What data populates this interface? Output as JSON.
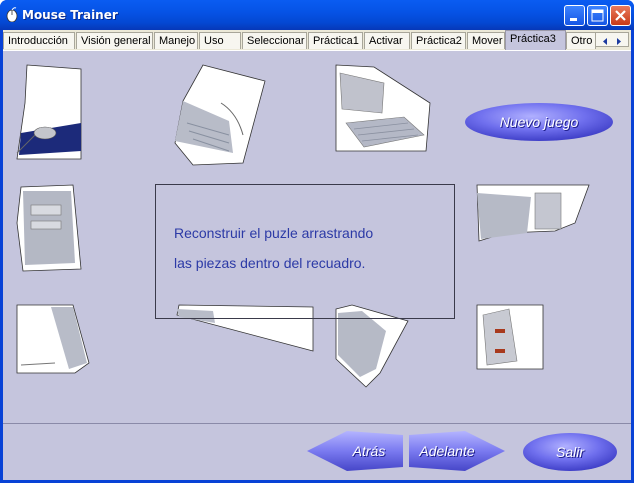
{
  "window": {
    "title": "Mouse Trainer",
    "controls": [
      "minimize",
      "maximize",
      "close"
    ]
  },
  "tabs": [
    {
      "label": "Introducción"
    },
    {
      "label": "Visión general"
    },
    {
      "label": "Manejo"
    },
    {
      "label": "Uso"
    },
    {
      "label": "Seleccionar"
    },
    {
      "label": "Práctica1"
    },
    {
      "label": "Activar"
    },
    {
      "label": "Práctica2"
    },
    {
      "label": "Mover"
    },
    {
      "label": "Práctica3",
      "active": true
    },
    {
      "label": "Otro"
    }
  ],
  "board": {
    "line1": "Reconstruir el puzle arrastrando",
    "line2": "las piezas dentro del recuadro."
  },
  "buttons": {
    "new_game": "Nuevo juego",
    "back": "Atrás",
    "forward": "Adelante",
    "exit": "Salir"
  },
  "colors": {
    "title_bar": "#0653e6",
    "client_bg": "#c5c5dd",
    "button_fill": "#7c7cf0",
    "board_text": "#2c3aa6"
  }
}
